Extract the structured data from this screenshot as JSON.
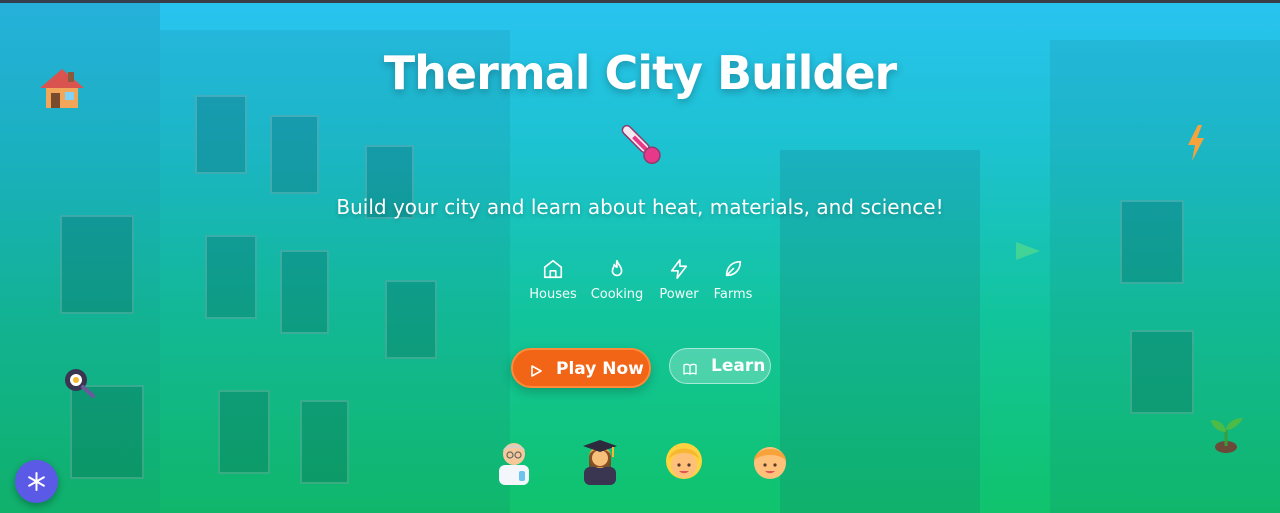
{
  "hero": {
    "title": "Thermal City Builder",
    "subtitle": "Build your city and learn about heat, materials, and science!",
    "topics": [
      {
        "label": "Houses",
        "icon": "home-icon"
      },
      {
        "label": "Cooking",
        "icon": "flame-icon"
      },
      {
        "label": "Power",
        "icon": "lightning-icon"
      },
      {
        "label": "Farms",
        "icon": "leaf-icon"
      }
    ],
    "play_button": {
      "label": "Play Now",
      "icon": "play-icon"
    },
    "learn_button": {
      "label": "Learn",
      "icon": "book-icon"
    }
  },
  "decorations": [
    "house-icon",
    "thermometer-icon",
    "lightning-icon",
    "frying-pan-icon",
    "seedling-icon"
  ],
  "characters": [
    "scientist-icon",
    "graduate-icon",
    "child-icon",
    "boy-icon"
  ],
  "floating_button": {
    "icon": "snowflake-icon"
  },
  "colors": {
    "gradient_top": "#29c3f0",
    "gradient_bottom": "#10c36c",
    "play_button": "#f26516",
    "fab": "#5a5ae6",
    "thermometer": "#e8388a"
  }
}
